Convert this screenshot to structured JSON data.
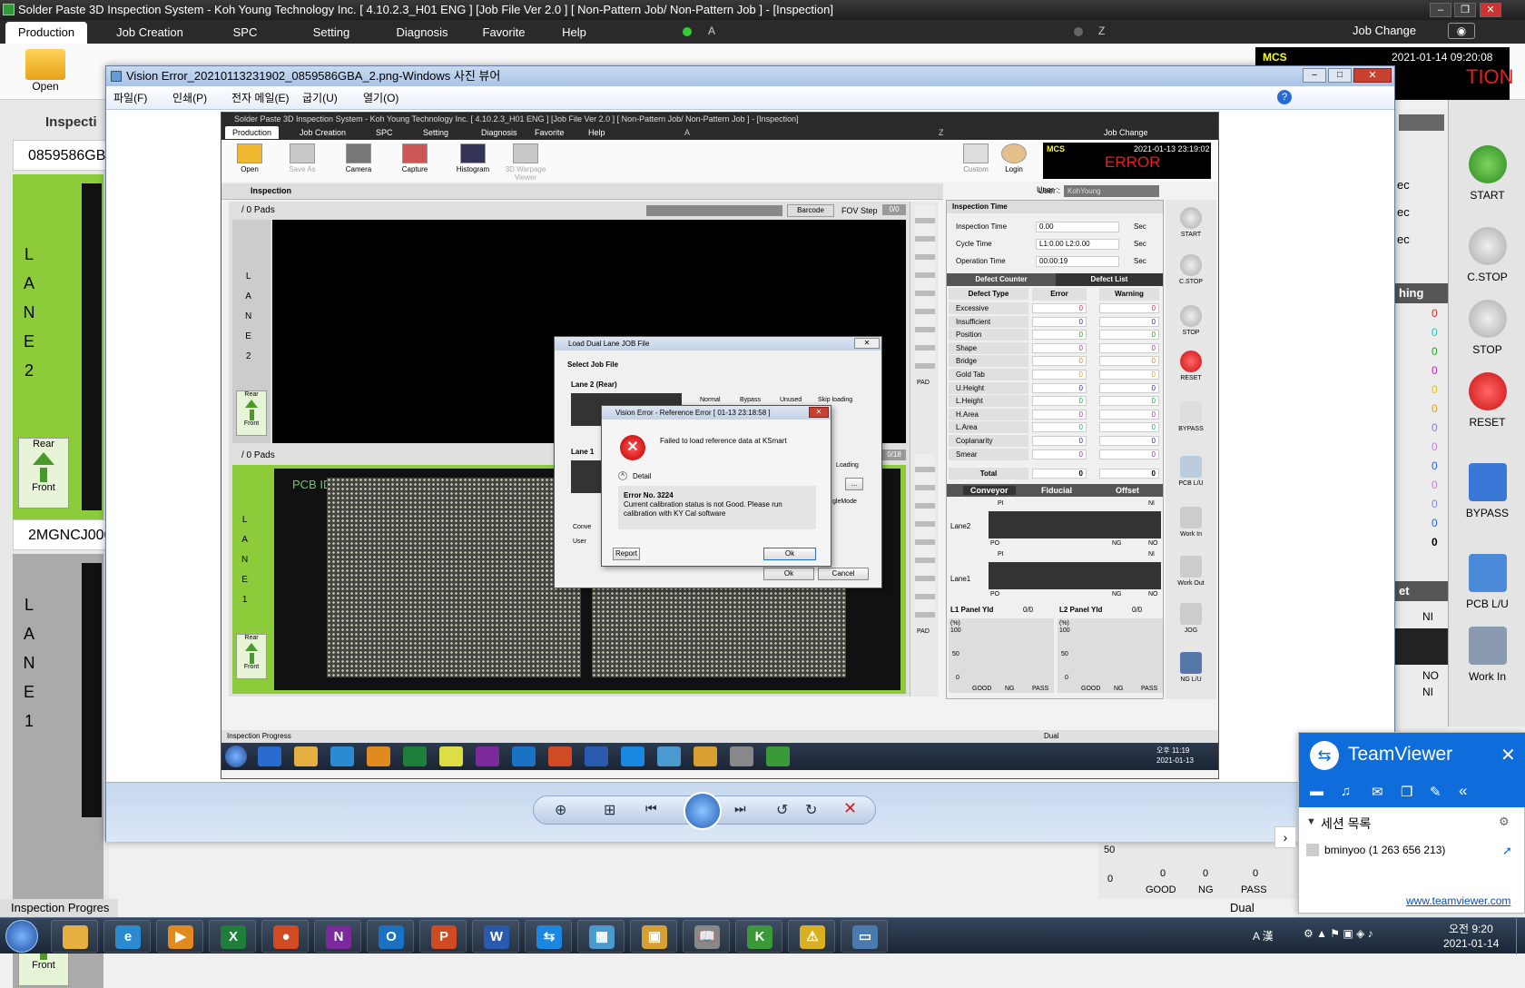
{
  "app": {
    "title": "Solder Paste 3D Inspection System - Koh Young Technology Inc. [ 4.10.2.3_H01 ENG ] [Job File Ver 2.0 ] [ Non-Pattern Job/ Non-Pattern Job ] - [Inspection]",
    "menu": [
      "Production",
      "Job Creation",
      "SPC",
      "Setting",
      "Diagnosis",
      "Favorite",
      "Help"
    ],
    "indicator_a": "A",
    "indicator_z": "Z",
    "job_change": "Job Change",
    "open_label": "Open",
    "inspection_tab": "Inspecti",
    "mcs": "MCS",
    "datetime": "2021-01-14  09:20:08",
    "status_partial": "TION",
    "lane2": {
      "pcb_id": "0859586GB",
      "letters": [
        "L",
        "A",
        "N",
        "E",
        "2"
      ]
    },
    "lane1": {
      "pcb_id": "2MGNCJ000",
      "letters": [
        "L",
        "A",
        "N",
        "E",
        "1"
      ]
    },
    "rear": "Rear",
    "front": "Front",
    "inspection_progress": "Inspection Progres",
    "dual": "Dual",
    "right_buttons": [
      "START",
      "C.STOP",
      "STOP",
      "RESET",
      "BYPASS",
      "PCB L/U",
      "Work In"
    ],
    "right_partials": {
      "ec1": "ec",
      "ec2": "ec",
      "ec3": "ec",
      "hing": "hing",
      "et": "et",
      "ni1": "NI",
      "no": "NO",
      "ni2": "NI"
    },
    "right_counts": [
      "0",
      "0",
      "0",
      "0",
      "0",
      "0",
      "0",
      "0",
      "0",
      "0",
      "0",
      "0",
      "0"
    ],
    "bottom_chart": {
      "y50": "50",
      "y0": "0",
      "good": "GOOD",
      "ng": "NG",
      "pass": "PASS",
      "v_good": "0",
      "v_ng": "0",
      "v_pass": "0"
    }
  },
  "viewer": {
    "title": "Vision Error_20210113231902_0859586GBA_2.png-Windows 사진 뷰어",
    "menu": [
      "파일(F)",
      "인쇄(P)",
      "전자 메일(E)",
      "굽기(U)",
      "열기(O)"
    ],
    "help": "?"
  },
  "inner": {
    "title": "Solder Paste 3D Inspection System - Koh Young Technology Inc. [ 4.10.2.3_H01 ENG ] [Job File Ver 2.0 ] [ Non-Pattern Job/ Non-Pattern Job ] - [Inspection]",
    "menu": [
      "Production",
      "Job Creation",
      "SPC",
      "Setting",
      "Diagnosis",
      "Favorite",
      "Help"
    ],
    "a": "A",
    "z": "Z",
    "job_change": "Job Change",
    "tools": [
      "Open",
      "Save As",
      "Camera",
      "Capture",
      "Histogram",
      "3D Warpage Viewer"
    ],
    "custom": "Custom",
    "login": "Login",
    "mcs": "MCS",
    "datetime": "2021-01-13  23:19:02",
    "error": "ERROR",
    "inspection": "Inspection",
    "user_label": "User :",
    "user": "KohYoung",
    "pads_top": "/ 0 Pads",
    "barcode": "Barcode",
    "fov_step": "FOV Step",
    "fov_val": "0/0",
    "pads_bottom": "/ 0 Pads",
    "fov_val2": "0/18",
    "lane2": [
      "L",
      "A",
      "N",
      "E",
      "2"
    ],
    "lane1": [
      "L",
      "A",
      "N",
      "E",
      "1"
    ],
    "rear": "Rear",
    "front": "Front",
    "pcb_id": "PCB ID : 000000",
    "pad": "PAD",
    "insp_time_header": "Inspection Time",
    "times": [
      {
        "label": "Inspection Time",
        "value": "0.00",
        "unit": "Sec"
      },
      {
        "label": "Cycle Time",
        "value": "L1:0.00 L2:0.00",
        "unit": "Sec"
      },
      {
        "label": "Operation Time",
        "value": "00:00:19",
        "unit": "Sec"
      }
    ],
    "defect_counter": "Defect Counter",
    "defect_list": "Defect List",
    "col_type": "Defect Type",
    "col_error": "Error",
    "col_warning": "Warning",
    "defects": [
      {
        "t": "Excessive",
        "e": "0",
        "w": "0"
      },
      {
        "t": "Insufficient",
        "e": "0",
        "w": "0"
      },
      {
        "t": "Position",
        "e": "0",
        "w": "0"
      },
      {
        "t": "Shape",
        "e": "0",
        "w": "0"
      },
      {
        "t": "Bridge",
        "e": "0",
        "w": "0"
      },
      {
        "t": "Gold Tab",
        "e": "0",
        "w": "0"
      },
      {
        "t": "U.Height",
        "e": "0",
        "w": "0"
      },
      {
        "t": "L.Height",
        "e": "0",
        "w": "0"
      },
      {
        "t": "H.Area",
        "e": "0",
        "w": "0"
      },
      {
        "t": "L.Area",
        "e": "0",
        "w": "0"
      },
      {
        "t": "Coplanarity",
        "e": "0",
        "w": "0"
      },
      {
        "t": "Smear",
        "e": "0",
        "w": "0"
      }
    ],
    "total": "Total",
    "total_e": "0",
    "total_w": "0",
    "tabs2": [
      "Conveyor",
      "Fiducial",
      "Offset"
    ],
    "lane2_label": "Lane2",
    "lane1_label": "Lane1",
    "pi": "PI",
    "po": "PO",
    "ni": "NI",
    "ng": "NG",
    "no": "NO",
    "yield_l1": "L1 Panel Yld",
    "yield_l1_val": "0/0",
    "yield_l2": "L2 Panel Yld",
    "yield_l2_val": "0/0",
    "pct": "(%)",
    "y100": "100",
    "y50": "50",
    "y0": "0",
    "zero": "0",
    "good": "GOOD",
    "ngl": "NG",
    "pass": "PASS",
    "right_buttons": [
      "START",
      "C.STOP",
      "STOP",
      "RESET",
      "BYPASS",
      "PCB L/U",
      "Work In",
      "Work Out",
      "JOG",
      "NG L/U"
    ],
    "progress": "Inspection Progress",
    "dual": "Dual",
    "clock_time": "오후 11:19",
    "clock_date": "2021-01-13"
  },
  "load_dialog": {
    "title": "Load Dual Lane JOB File",
    "group": "Select Job File",
    "lane2": "Lane 2 (Rear)",
    "lane1": "Lane 1",
    "options": [
      "Normal",
      "Bypass",
      "Unused",
      "Skip loading"
    ],
    "loading": "Loading",
    "mode": "gleMode",
    "conv": "Conve",
    "user": "User",
    "ok": "Ok",
    "cancel": "Cancel",
    "dots": "..."
  },
  "error_dialog": {
    "title": "Vision Error - Reference Error [ 01-13 23:18:58 ]",
    "message": "Failed to load reference data at KSmart",
    "detail": "Detail",
    "error_no": "Error No. 3224",
    "desc": "Current calibration status is not Good. Please run calibration with KY Cal software",
    "report": "Report",
    "ok": "Ok"
  },
  "teamviewer": {
    "name": "TeamViewer",
    "session_list": "세션 목록",
    "user": "bminyoo (1 263 656 213)",
    "link": "www.teamviewer.com"
  },
  "taskbar": {
    "time": "오전 9:20",
    "date": "2021-01-14",
    "ime": "A 漢"
  },
  "colors": {
    "lane_green": "#8ccc3a",
    "error_red": "#e02020",
    "tv_blue": "#0e6ddb"
  }
}
